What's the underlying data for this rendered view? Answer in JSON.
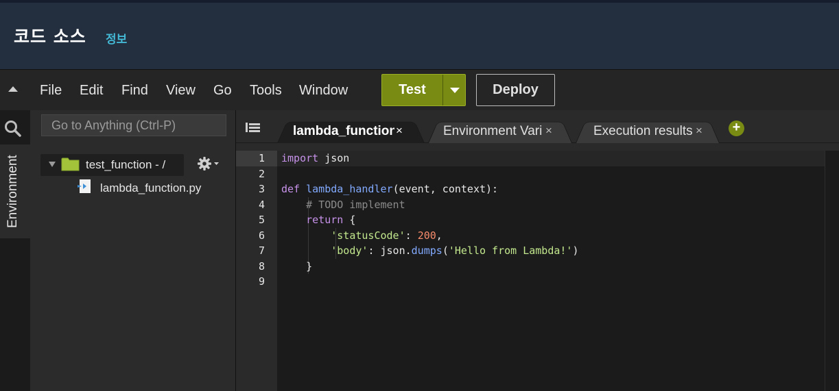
{
  "header": {
    "title": "코드 소스",
    "info_link": "정보"
  },
  "menubar": {
    "items": [
      "File",
      "Edit",
      "Find",
      "View",
      "Go",
      "Tools",
      "Window"
    ],
    "test_label": "Test",
    "deploy_label": "Deploy"
  },
  "sidebar": {
    "search_icon": "search-icon",
    "environment_tab": "Environment"
  },
  "tree": {
    "goto_placeholder": "Go to Anything (Ctrl-P)",
    "root_label": "test_function - /",
    "file_label": "lambda_function.py"
  },
  "editor": {
    "tabs": [
      {
        "label": "lambda_function",
        "active": true
      },
      {
        "label": "Environment Vari",
        "active": false
      },
      {
        "label": "Execution results",
        "active": false
      }
    ],
    "tab_close_glyph": "×",
    "add_tab_glyph": "+",
    "line_numbers": [
      "1",
      "2",
      "3",
      "4",
      "5",
      "6",
      "7",
      "8",
      "9"
    ],
    "code": {
      "l1_kw": "import",
      "l1_rest": " json",
      "l3_kw": "def",
      "l3_fn": "lambda_handler",
      "l3_rest": "(event, context):",
      "l4_comment": "# TODO implement",
      "l5_kw": "return",
      "l5_rest": " {",
      "l6_key": "'statusCode'",
      "l6_sep": ": ",
      "l6_num": "200",
      "l6_end": ",",
      "l7_key": "'body'",
      "l7_sep": ": json.",
      "l7_fn": "dumps",
      "l7_open": "(",
      "l7_str": "'Hello from Lambda!'",
      "l7_close": ")",
      "l8": "}"
    }
  },
  "colors": {
    "header_bg": "#232f3e",
    "accent_green": "#7a8b13",
    "info_link": "#44b9d6"
  }
}
